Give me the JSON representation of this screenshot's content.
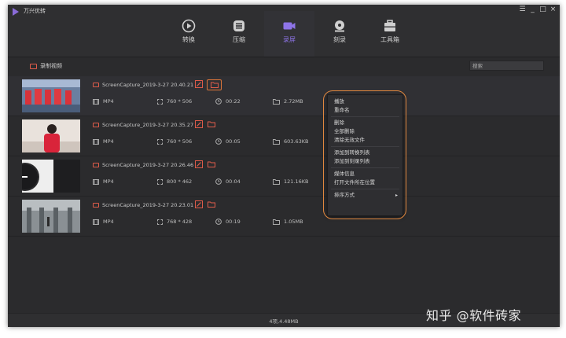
{
  "app": {
    "title": "万兴优转"
  },
  "window_controls": [
    "☰",
    "_",
    "□",
    "×"
  ],
  "nav": [
    {
      "label": "转换",
      "icon": "play-circle-icon",
      "active": false
    },
    {
      "label": "压缩",
      "icon": "compress-icon",
      "active": false
    },
    {
      "label": "录屏",
      "icon": "video-camera-icon",
      "active": true
    },
    {
      "label": "刻录",
      "icon": "disc-icon",
      "active": false
    },
    {
      "label": "工具箱",
      "icon": "toolbox-icon",
      "active": false
    }
  ],
  "toolbar": {
    "record_label": "录制视频",
    "search_placeholder": "搜索"
  },
  "files": [
    {
      "name": "ScreenCapture_2019-3-27 20.40.21",
      "format": "MP4",
      "resolution": "760 * 506",
      "duration": "00:22",
      "size": "2.72MB"
    },
    {
      "name": "ScreenCapture_2019-3-27 20.35.27",
      "format": "MP4",
      "resolution": "760 * 506",
      "duration": "00:05",
      "size": "603.63KB"
    },
    {
      "name": "ScreenCapture_2019-3-27 20.26.46",
      "format": "MP4",
      "resolution": "800 * 462",
      "duration": "00:04",
      "size": "121.16KB"
    },
    {
      "name": "ScreenCapture_2019-3-27 20.23.01",
      "format": "MP4",
      "resolution": "768 * 428",
      "duration": "00:19",
      "size": "1.05MB"
    }
  ],
  "context_menu": {
    "play": "播放",
    "rename": "重命名",
    "delete": "删除",
    "delete_all": "全部删除",
    "clear_invalid": "清除无效文件",
    "add_convert": "添加到转换列表",
    "add_burn": "添加到刻录列表",
    "media_info": "媒体信息",
    "open_location": "打开文件所在位置",
    "sort": "排序方式",
    "sort_arrow": "▸"
  },
  "status": {
    "summary": "4项,4.48MB"
  },
  "watermark": "知乎 @软件砖家",
  "colors": {
    "accent": "#8a6bd8",
    "highlight": "#e0873e",
    "record_red": "#e05c4a"
  }
}
